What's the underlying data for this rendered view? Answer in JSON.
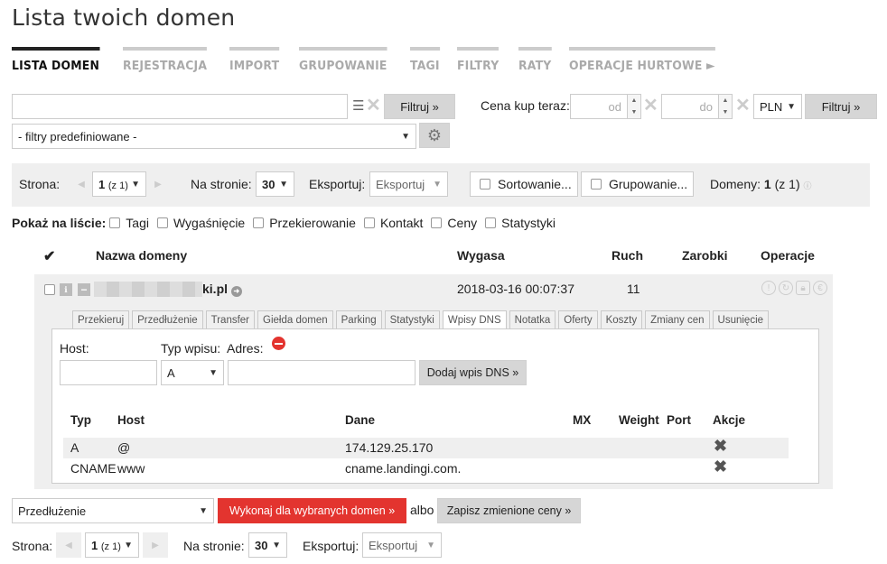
{
  "page": {
    "title": "Lista twoich domen"
  },
  "tabs": [
    {
      "label": "LISTA DOMEN"
    },
    {
      "label": "REJESTRACJA"
    },
    {
      "label": "IMPORT"
    },
    {
      "label": "GRUPOWANIE"
    },
    {
      "label": "TAGI"
    },
    {
      "label": "FILTRY"
    },
    {
      "label": "RATY"
    },
    {
      "label": "OPERACJE HURTOWE ►"
    }
  ],
  "filters": {
    "search_value": "",
    "filter_button": "Filtruj »",
    "predefined_select": "- filtry predefiniowane -",
    "price_label": "Cena kup teraz:",
    "from_placeholder": "od",
    "to_placeholder": "do",
    "currency": "PLN",
    "price_filter_button": "Filtruj »"
  },
  "pager_top": {
    "page_label": "Strona:",
    "page_value": "1",
    "page_of": "(z 1)",
    "per_page_label": "Na stronie:",
    "per_page_value": "30",
    "export_label": "Eksportuj:",
    "export_value": "Eksportuj",
    "sort_button": "Sortowanie...",
    "group_button": "Grupowanie...",
    "domains_label": "Domeny:",
    "domains_count": "1",
    "domains_of": "(z 1)"
  },
  "show_list": {
    "label": "Pokaż na liście:",
    "options": [
      "Tagi",
      "Wygaśnięcie",
      "Przekierowanie",
      "Kontakt",
      "Ceny",
      "Statystyki"
    ]
  },
  "table": {
    "headers": {
      "check": "✔",
      "name": "Nazwa domeny",
      "expires": "Wygasa",
      "traffic": "Ruch",
      "earnings": "Zarobki",
      "operations": "Operacje"
    },
    "row": {
      "domain_suffix": "ki.pl",
      "expires": "2018-03-16 00:07:37",
      "traffic": "11"
    }
  },
  "subtabs": [
    "Przekieruj",
    "Przedłużenie",
    "Transfer",
    "Giełda domen",
    "Parking",
    "Statystyki",
    "Wpisy DNS",
    "Notatka",
    "Oferty",
    "Koszty",
    "Zmiany cen",
    "Usunięcie"
  ],
  "dns_form": {
    "host_label": "Host:",
    "type_label": "Typ wpisu:",
    "address_label": "Adres:",
    "type_value": "A",
    "add_button": "Dodaj wpis DNS »"
  },
  "dns_table": {
    "headers": {
      "type": "Typ",
      "host": "Host",
      "data": "Dane",
      "mx": "MX",
      "weight": "Weight",
      "port": "Port",
      "actions": "Akcje"
    },
    "rows": [
      {
        "type": "A",
        "host": "@",
        "data": "174.129.25.170"
      },
      {
        "type": "CNAME",
        "host": "www",
        "data": "cname.landingi.com."
      }
    ]
  },
  "bulk": {
    "action_select": "Przedłużenie",
    "execute_button": "Wykonaj dla wybranych domen »",
    "or_text": "albo",
    "save_prices_button": "Zapisz zmienione ceny »"
  },
  "pager_bottom": {
    "page_label": "Strona:",
    "page_value": "1",
    "page_of": "(z 1)",
    "per_page_label": "Na stronie:",
    "per_page_value": "30",
    "export_label": "Eksportuj:",
    "export_value": "Eksportuj"
  },
  "colors": {
    "accent_red": "#e3342f",
    "gray_button": "#d6d6d6",
    "bar_bg": "#efefef"
  }
}
